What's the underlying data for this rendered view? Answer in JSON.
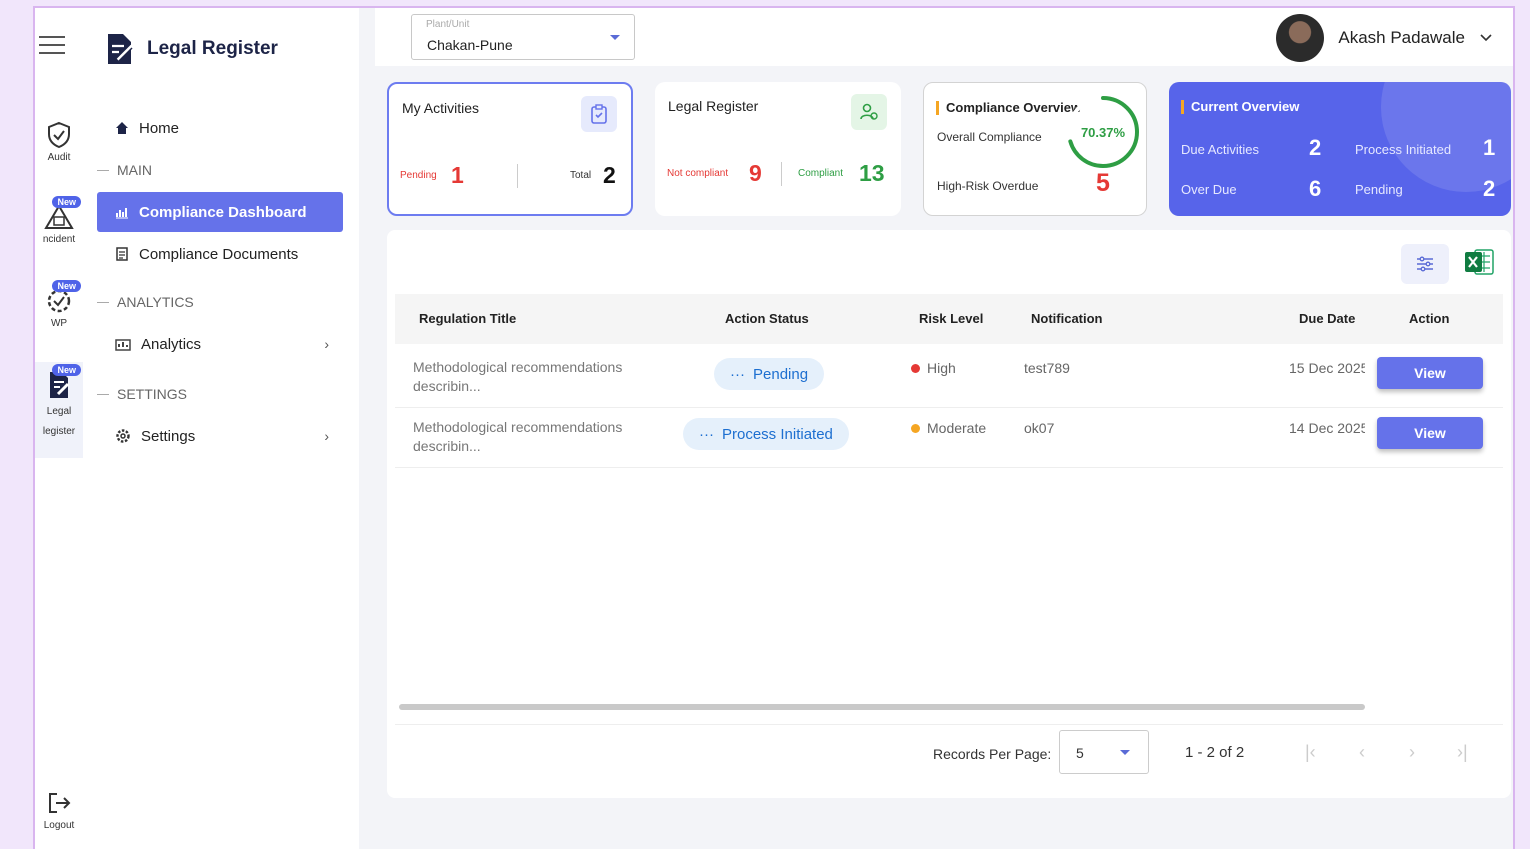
{
  "rail": {
    "items": [
      {
        "label": "Audit"
      },
      {
        "label": "ncident",
        "badge": "New"
      },
      {
        "label": "WP",
        "badge": "New"
      },
      {
        "label": "Legal\nlegister",
        "badge": "New"
      },
      {
        "label": "Logout"
      }
    ]
  },
  "brand": {
    "title": "Legal Register"
  },
  "nav": {
    "home": "Home",
    "main_section": "MAIN",
    "compliance_dashboard": "Compliance Dashboard",
    "compliance_documents": "Compliance Documents",
    "analytics_section": "ANALYTICS",
    "analytics": "Analytics",
    "settings_section": "SETTINGS",
    "settings": "Settings"
  },
  "topbar": {
    "plant_label": "Plant/Unit",
    "plant_value": "Chakan-Pune",
    "user_name": "Akash Padawale"
  },
  "cards": {
    "my_activities": {
      "title": "My Activities",
      "pending_label": "Pending",
      "pending_value": "1",
      "total_label": "Total",
      "total_value": "2"
    },
    "legal_register": {
      "title": "Legal Register",
      "not_compliant_label": "Not compliant",
      "not_compliant_value": "9",
      "compliant_label": "Compliant",
      "compliant_value": "13"
    },
    "compliance_overview": {
      "title": "Compliance Overview",
      "overall_label": "Overall Compliance",
      "overall_value": "70.37%",
      "overall_fraction": 0.7037,
      "high_risk_label": "High-Risk Overdue",
      "high_risk_value": "5"
    },
    "current_overview": {
      "title": "Current Overview",
      "due_label": "Due Activities",
      "due_value": "2",
      "process_label": "Process Initiated",
      "process_value": "1",
      "overdue_label": "Over Due",
      "overdue_value": "6",
      "pending_label": "Pending",
      "pending_value": "2"
    }
  },
  "table": {
    "headers": {
      "title": "Regulation Title",
      "status": "Action Status",
      "risk": "Risk Level",
      "notification": "Notification",
      "due": "Due Date",
      "action": "Action"
    },
    "rows": [
      {
        "title": "Methodological recommendations describin...",
        "status": "Pending",
        "risk": "High",
        "risk_color": "#e53935",
        "notification": "test789",
        "due": "15 Dec 2025",
        "action": "View"
      },
      {
        "title": "Methodological recommendations describin...",
        "status": "Process Initiated",
        "risk": "Moderate",
        "risk_color": "#f5a623",
        "notification": "ok07",
        "due": "14 Dec 2025",
        "action": "View"
      }
    ]
  },
  "pager": {
    "records_label": "Records Per Page:",
    "records_value": "5",
    "range": "1 - 2 of 2"
  },
  "colors": {
    "accent": "#6572ea",
    "overview_bg": "#5764ea",
    "danger": "#e53935",
    "success": "#2e9e44"
  }
}
